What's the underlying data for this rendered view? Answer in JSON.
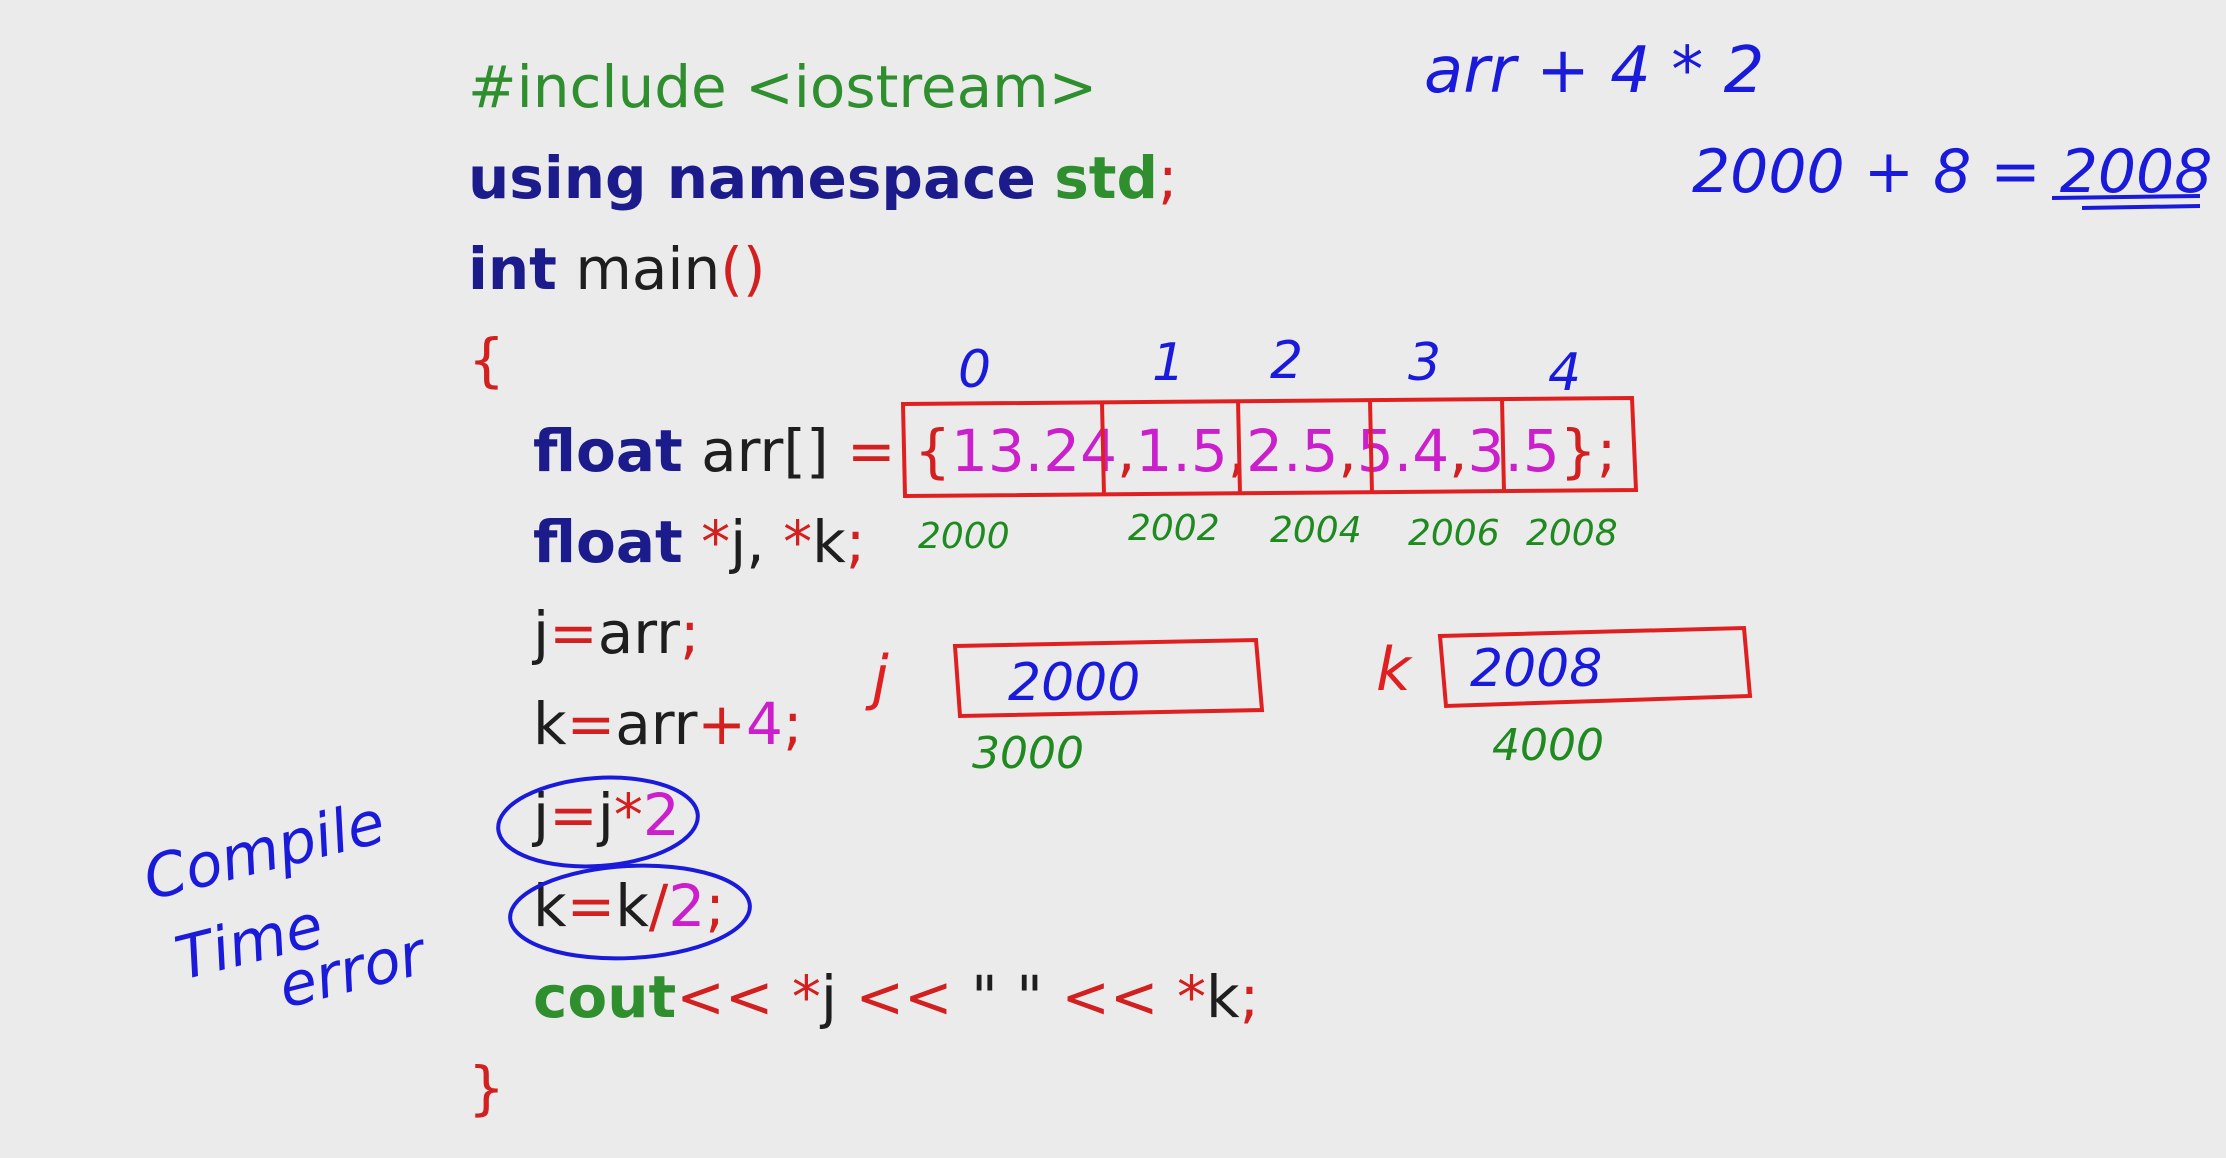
{
  "code": {
    "include": "#include <iostream>",
    "using_kw": "using namespace",
    "using_std": "std",
    "semi": ";",
    "int_kw": "int",
    "main_name": "main",
    "parens": "()",
    "open_brace": "{",
    "close_brace": "}",
    "float_kw": "float",
    "arr_decl": "arr[]",
    "eq_brace": " = {",
    "arr_vals": [
      "13.24",
      "1.5",
      "2.5",
      "5.4",
      "3.5"
    ],
    "comma": ",",
    "close_arr": "};",
    "ptr_decl_a": "*",
    "ptr_decl_j": "j, ",
    "ptr_decl_k": "k",
    "line_j_assign": "j",
    "line_eq": "=",
    "arr_name": "arr",
    "plus": "+",
    "four": "4",
    "k_name": "k",
    "star": "*",
    "two": "2",
    "slash": "/",
    "cout_kw": "cout",
    "shift": "<< ",
    "quote_space": "\" \" ",
    "shift2": "<< "
  },
  "annotations": {
    "indices": [
      "0",
      "1",
      "2",
      "3",
      "4"
    ],
    "addresses": [
      "2000",
      "2002",
      "2004",
      "2006",
      "2008"
    ],
    "j_label": "j",
    "j_value": "2000",
    "j_addr": "3000",
    "k_label": "k",
    "k_value": "2008",
    "k_addr": "4000",
    "formula1": "arr + 4 * 2",
    "formula2": "2000 + 8 = 2008",
    "note": [
      "Compile",
      "Time",
      "error"
    ]
  },
  "colors": {
    "keyword": "#1b1b8c",
    "library": "#2f8f2f",
    "operator": "#d21f1f",
    "number": "#cc1fcc",
    "ink_blue": "#1a1adb",
    "ink_green": "#1f8a1f",
    "ink_red": "#e02020"
  }
}
